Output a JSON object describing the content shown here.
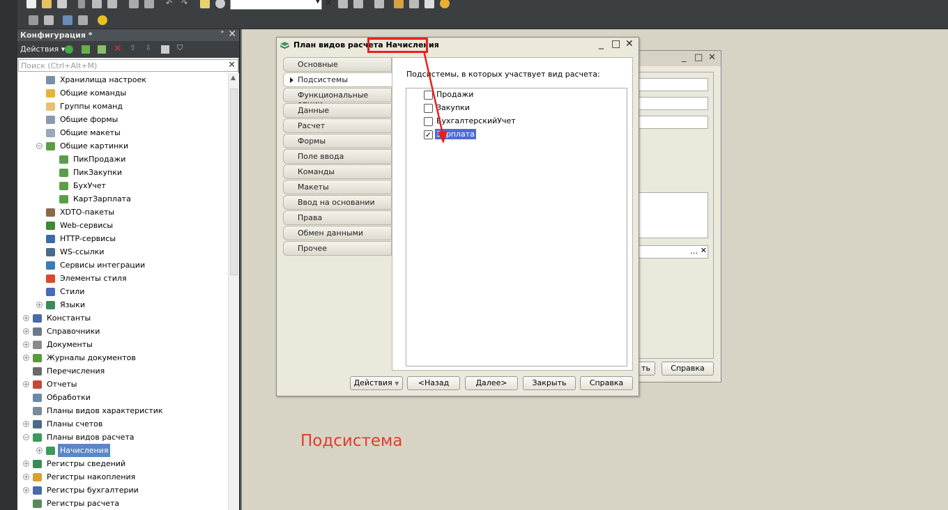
{
  "toolbar": {},
  "config_panel": {
    "title": "Конфигурация *",
    "actions_label": "Действия",
    "search_placeholder": "Поиск (Ctrl+Alt+M)"
  },
  "tree": [
    {
      "label": "Хранилища настроек",
      "level": 2,
      "icon": "settings-storage-icon",
      "color": "#7a8fa8"
    },
    {
      "label": "Общие команды",
      "level": 2,
      "icon": "common-commands-icon",
      "color": "#e8b23a"
    },
    {
      "label": "Группы команд",
      "level": 2,
      "icon": "command-groups-icon",
      "color": "#e8c070"
    },
    {
      "label": "Общие формы",
      "level": 2,
      "icon": "common-forms-icon",
      "color": "#8a9ab0"
    },
    {
      "label": "Общие макеты",
      "level": 2,
      "icon": "common-layouts-icon",
      "color": "#9aa8b8"
    },
    {
      "label": "Общие картинки",
      "level": 2,
      "icon": "common-pictures-icon",
      "color": "#5b9e4a",
      "expanded": true
    },
    {
      "label": "ПикПродажи",
      "level": 3,
      "icon": "picture-icon",
      "color": "#5b9e4a"
    },
    {
      "label": "ПикЗакупки",
      "level": 3,
      "icon": "picture-icon",
      "color": "#5b9e4a"
    },
    {
      "label": "БухУчет",
      "level": 3,
      "icon": "picture-icon",
      "color": "#5b9e4a"
    },
    {
      "label": "КартЗарплата",
      "level": 3,
      "icon": "picture-icon",
      "color": "#5b9e4a"
    },
    {
      "label": "XDTO-пакеты",
      "level": 2,
      "icon": "xdto-icon",
      "color": "#8a6a4a"
    },
    {
      "label": "Web-сервисы",
      "level": 2,
      "icon": "web-services-icon",
      "color": "#3a8a3a"
    },
    {
      "label": "HTTP-сервисы",
      "level": 2,
      "icon": "http-services-icon",
      "color": "#3a6aa8"
    },
    {
      "label": "WS-ссылки",
      "level": 2,
      "icon": "ws-links-icon",
      "color": "#4a6a8a"
    },
    {
      "label": "Сервисы интеграции",
      "level": 2,
      "icon": "integration-services-icon",
      "color": "#3a7ab8"
    },
    {
      "label": "Элементы стиля",
      "level": 2,
      "icon": "style-elements-icon",
      "color": "#d84a2a"
    },
    {
      "label": "Стили",
      "level": 2,
      "icon": "styles-icon",
      "color": "#4a6ab8"
    },
    {
      "label": "Языки",
      "level": 2,
      "icon": "languages-icon",
      "color": "#3a8a5a",
      "collapsed": true
    },
    {
      "label": "Константы",
      "level": 1,
      "icon": "constants-icon",
      "color": "#4a6aa8",
      "collapsed": true
    },
    {
      "label": "Справочники",
      "level": 1,
      "icon": "catalogs-icon",
      "color": "#6a7a8a",
      "collapsed": true
    },
    {
      "label": "Документы",
      "level": 1,
      "icon": "documents-icon",
      "color": "#8a8a8a",
      "collapsed": true
    },
    {
      "label": "Журналы документов",
      "level": 1,
      "icon": "document-journals-icon",
      "color": "#5a9a3a",
      "collapsed": true
    },
    {
      "label": "Перечисления",
      "level": 1,
      "icon": "enumerations-icon",
      "color": "#6a6a6a"
    },
    {
      "label": "Отчеты",
      "level": 1,
      "icon": "reports-icon",
      "color": "#c04a3a",
      "collapsed": true
    },
    {
      "label": "Обработки",
      "level": 1,
      "icon": "data-processors-icon",
      "color": "#6a8aa8"
    },
    {
      "label": "Планы видов характеристик",
      "level": 1,
      "icon": "characteristic-types-icon",
      "color": "#7a8a9a"
    },
    {
      "label": "Планы счетов",
      "level": 1,
      "icon": "charts-of-accounts-icon",
      "color": "#4a6a8a",
      "collapsed": true
    },
    {
      "label": "Планы видов расчета",
      "level": 1,
      "icon": "calculation-types-icon",
      "color": "#3a9a5a",
      "expanded": true
    },
    {
      "label": "Начисления",
      "level": 2,
      "icon": "calculation-type-icon",
      "color": "#3a9a5a",
      "collapsed": true,
      "selected": true
    },
    {
      "label": "Регистры сведений",
      "level": 1,
      "icon": "information-registers-icon",
      "color": "#3a8a5a",
      "collapsed": true
    },
    {
      "label": "Регистры накопления",
      "level": 1,
      "icon": "accumulation-registers-icon",
      "color": "#d8a030",
      "collapsed": true
    },
    {
      "label": "Регистры бухгалтерии",
      "level": 1,
      "icon": "accounting-registers-icon",
      "color": "#4a6aa8",
      "collapsed": true
    },
    {
      "label": "Регистры расчета",
      "level": 1,
      "icon": "calculation-registers-icon",
      "color": "#5a8a5a"
    }
  ],
  "back_window": {
    "buttons": [
      "ть",
      "Справка"
    ]
  },
  "dialog": {
    "title_prefix": "План видов расчета",
    "title_highlight": "Начисления",
    "tabs": [
      "Основные",
      "Подсистемы",
      "Функциональные опции",
      "Данные",
      "Расчет",
      "Формы",
      "Поле ввода",
      "Команды",
      "Макеты",
      "Ввод на основании",
      "Права",
      "Обмен данными",
      "Прочее"
    ],
    "active_tab": 1,
    "panel_header": "Подсистемы, в которых участвует вид расчета:",
    "subsystems": [
      {
        "label": "Продажи",
        "checked": false
      },
      {
        "label": "Закупки",
        "checked": false
      },
      {
        "label": "БухгалтерскийУчет",
        "checked": false
      },
      {
        "label": "Зарплата",
        "checked": true,
        "selected": true
      }
    ],
    "buttons": {
      "actions": "Действия",
      "back": "<Назад",
      "next": "Далее>",
      "close": "Закрыть",
      "help": "Справка"
    }
  },
  "annotation": {
    "caption": "Подсистема",
    "color": "#e33b2e"
  }
}
